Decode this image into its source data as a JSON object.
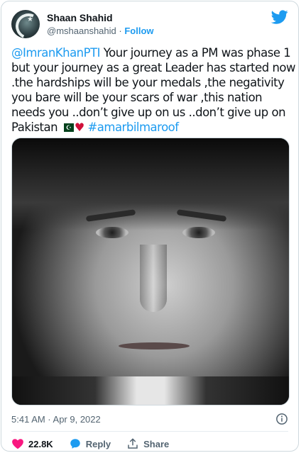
{
  "author": {
    "name": "Shaan Shahid",
    "handle": "@mshaanshahid",
    "separator": "·",
    "follow_label": "Follow"
  },
  "tweet": {
    "mention": "@ImranKhanPTI",
    "body": " Your journey as a PM was phase 1 but your journey as a great Leader has started now .the hardships will be your medals ,the negativity you bare will be your scars of war ,this nation needs you ..don’t give up on us ..don’t give up on Pakistan ",
    "hashtag": "#amarbilmaroof",
    "emojis": [
      "pakistan-flag",
      "red-heart"
    ]
  },
  "meta": {
    "timestamp": "5:41 AM · Apr 9, 2022"
  },
  "actions": {
    "likes": "22.8K",
    "reply_label": "Reply",
    "share_label": "Share"
  },
  "colors": {
    "accent": "#1d9bf0",
    "like": "#f91880",
    "text": "#0f1419",
    "muted": "#536471"
  }
}
